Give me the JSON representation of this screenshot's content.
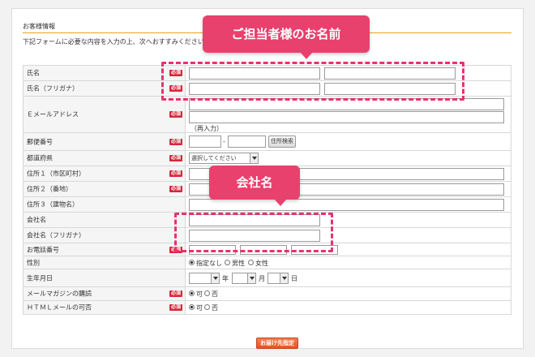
{
  "section": {
    "title": "お客様情報",
    "intro": "下記フォームに必要な内容を入力の上、次へおすすみください"
  },
  "required_badge": "必須",
  "rows": {
    "name": {
      "label": "氏名"
    },
    "name_kana": {
      "label": "氏名（フリガナ）"
    },
    "email": {
      "label": "Ｅメールアドレス",
      "reenter_note": "（再入力）"
    },
    "postal": {
      "label": "郵便番号",
      "separator": "-",
      "search_button": "住所検索"
    },
    "prefecture": {
      "label": "都道府県",
      "selected": "選択してください"
    },
    "address1": {
      "label": "住所１（市区町村）"
    },
    "address2": {
      "label": "住所２（番地）"
    },
    "address3": {
      "label": "住所３（建物名）"
    },
    "company": {
      "label": "会社名"
    },
    "company_kana": {
      "label": "会社名（フリガナ）"
    },
    "phone": {
      "label": "お電話番号"
    },
    "gender": {
      "label": "性別",
      "options": [
        "指定なし",
        "男性",
        "女性"
      ],
      "selected_index": 0
    },
    "birthday": {
      "label": "生年月日",
      "year": "年",
      "month": "月",
      "day": "日"
    },
    "newsletter": {
      "label": "メールマガジンの購読",
      "options": [
        "可",
        "否"
      ],
      "selected_index": 0
    },
    "html_mail": {
      "label": "ＨＴＭＬメールの可否",
      "options": [
        "可",
        "否"
      ],
      "selected_index": 0
    }
  },
  "callouts": {
    "contact_name": "ご担当者様のお名前",
    "company_name": "会社名"
  },
  "submit_button": "お届け先指定",
  "colors": {
    "accent": "#e8416e",
    "required": "#d9253a",
    "rule": "#f0a020"
  }
}
